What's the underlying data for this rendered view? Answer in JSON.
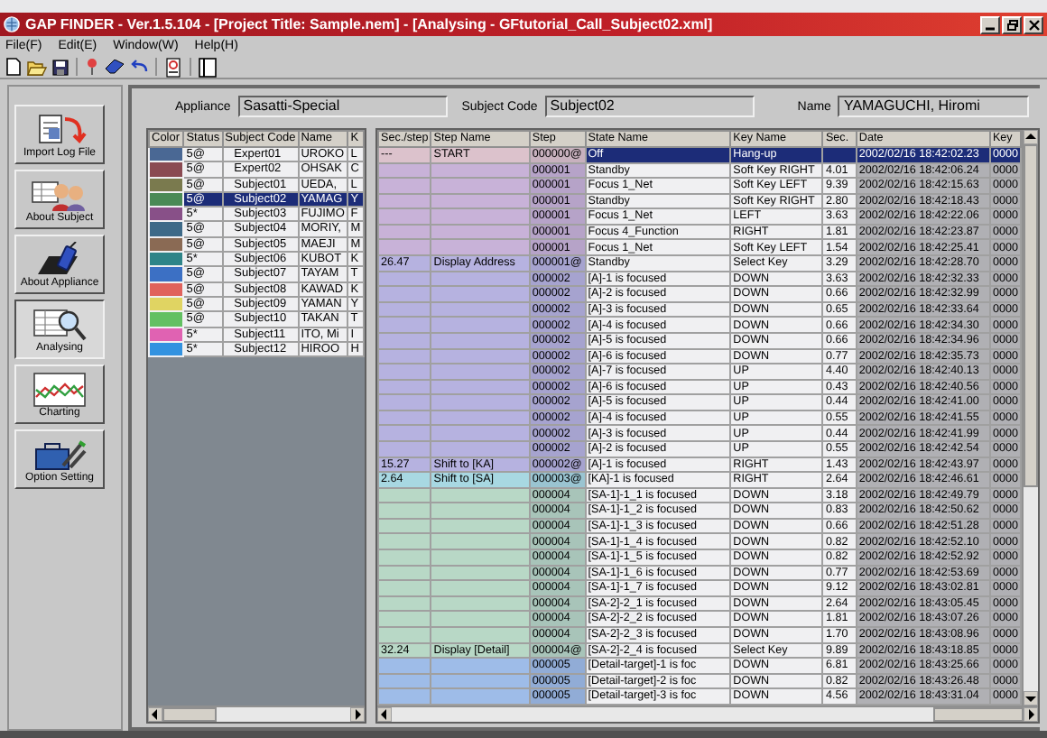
{
  "window": {
    "title": "GAP FINDER - Ver.1.5.104 - [Project Title: Sample.nem] - [Analysing - GFtutorial_Call_Subject02.xml]"
  },
  "menu": [
    "File(F)",
    "Edit(E)",
    "Window(W)",
    "Help(H)"
  ],
  "nav": [
    {
      "label": "Import Log File",
      "kind": "import",
      "selected": false
    },
    {
      "label": "About Subject",
      "kind": "subject",
      "selected": false
    },
    {
      "label": "About Appliance",
      "kind": "appliance",
      "selected": false
    },
    {
      "label": "Analysing",
      "kind": "analysing",
      "selected": true
    },
    {
      "label": "Charting",
      "kind": "charting",
      "selected": false
    },
    {
      "label": "Option Setting",
      "kind": "option",
      "selected": false
    }
  ],
  "header": {
    "appliance_label": "Appliance",
    "appliance": "Sasatti-Special",
    "subject_code_label": "Subject Code",
    "subject_code": "Subject02",
    "name_label": "Name",
    "name": "YAMAGUCHI, Hiromi"
  },
  "subjects": {
    "columns": [
      "Color",
      "Status",
      "Subject Code",
      "Name",
      "K"
    ],
    "rows": [
      {
        "color": "#4a6894",
        "status": "5@",
        "code": "Expert01",
        "name": "UROKO",
        "column_5": "L",
        "selected": false
      },
      {
        "color": "#8a4a52",
        "status": "5@",
        "code": "Expert02",
        "name": "OHSAK",
        "column_5": "C",
        "selected": false
      },
      {
        "color": "#7a7a4e",
        "status": "5@",
        "code": "Subject01",
        "name": "UEDA,",
        "column_5": "L",
        "selected": false
      },
      {
        "color": "#4a8a56",
        "status": "5@",
        "code": "Subject02",
        "name": "YAMAG",
        "column_5": "Y",
        "selected": true
      },
      {
        "color": "#885088",
        "status": "5*",
        "code": "Subject03",
        "name": "FUJIMO",
        "column_5": "F",
        "selected": false
      },
      {
        "color": "#3e6a88",
        "status": "5@",
        "code": "Subject04",
        "name": "MORIY,",
        "column_5": "M",
        "selected": false
      },
      {
        "color": "#8a6a54",
        "status": "5@",
        "code": "Subject05",
        "name": "MAEJI",
        "column_5": "M",
        "selected": false
      },
      {
        "color": "#2e8488",
        "status": "5*",
        "code": "Subject06",
        "name": "KUBOT",
        "column_5": "K",
        "selected": false
      },
      {
        "color": "#3c70c4",
        "status": "5@",
        "code": "Subject07",
        "name": "TAYAM",
        "column_5": "T",
        "selected": false
      },
      {
        "color": "#e0625c",
        "status": "5@",
        "code": "Subject08",
        "name": "KAWAD",
        "column_5": "K",
        "selected": false
      },
      {
        "color": "#e0d462",
        "status": "5@",
        "code": "Subject09",
        "name": "YAMAN",
        "column_5": "Y",
        "selected": false
      },
      {
        "color": "#62c062",
        "status": "5@",
        "code": "Subject10",
        "name": "TAKAN",
        "column_5": "T",
        "selected": false
      },
      {
        "color": "#e062b2",
        "status": "5*",
        "code": "Subject11",
        "name": "ITO, Mi",
        "column_5": "I",
        "selected": false
      },
      {
        "color": "#3292e0",
        "status": "5*",
        "code": "Subject12",
        "name": "HIROO",
        "column_5": "H",
        "selected": false
      }
    ]
  },
  "steps": {
    "columns": [
      "Sec./step",
      "Step Name",
      "Step",
      "State Name",
      "Key Name",
      "Sec.",
      "Date",
      "Key"
    ],
    "rows": [
      {
        "sec_step": "---",
        "step_name": "START",
        "step": "000000@",
        "state_name": "Off",
        "key_name": "Hang-up",
        "date": "2002/02/16 18:42:02.23",
        "key": "0000",
        "color": "#dcc2cc",
        "selected": true
      },
      {
        "step": "000001",
        "state_name": "Standby",
        "key_name": "Soft Key RIGHT",
        "sec": "4.01",
        "date": "2002/02/16 18:42:06.24",
        "key": "0000",
        "color": "#c8b2d8",
        "selected": false
      },
      {
        "step": "000001",
        "state_name": "Focus 1_Net",
        "key_name": "Soft Key LEFT",
        "sec": "9.39",
        "date": "2002/02/16 18:42:15.63",
        "key": "0000",
        "color": "#c8b2d8",
        "selected": false
      },
      {
        "step": "000001",
        "state_name": "Standby",
        "key_name": "Soft Key RIGHT",
        "sec": "2.80",
        "date": "2002/02/16 18:42:18.43",
        "key": "0000",
        "color": "#c8b2d8",
        "selected": false
      },
      {
        "step": "000001",
        "state_name": "Focus 1_Net",
        "key_name": "LEFT",
        "sec": "3.63",
        "date": "2002/02/16 18:42:22.06",
        "key": "0000",
        "color": "#c8b2d8",
        "selected": false
      },
      {
        "step": "000001",
        "state_name": "Focus 4_Function",
        "key_name": "RIGHT",
        "sec": "1.81",
        "date": "2002/02/16 18:42:23.87",
        "key": "0000",
        "color": "#c8b2d8",
        "selected": false
      },
      {
        "step": "000001",
        "state_name": "Focus 1_Net",
        "key_name": "Soft Key LEFT",
        "sec": "1.54",
        "date": "2002/02/16 18:42:25.41",
        "key": "0000",
        "color": "#c8b2d8",
        "selected": false
      },
      {
        "sec_step": "26.47",
        "step_name": "Display Address",
        "step": "000001@",
        "state_name": "Standby",
        "key_name": "Select Key",
        "sec": "3.29",
        "date": "2002/02/16 18:42:28.70",
        "key": "0000",
        "color": "#b6b2e0",
        "selected": false
      },
      {
        "step": "000002",
        "state_name": "[A]-1 is focused",
        "key_name": "DOWN",
        "sec": "3.63",
        "date": "2002/02/16 18:42:32.33",
        "key": "0000",
        "color": "#b6b2e0",
        "selected": false
      },
      {
        "step": "000002",
        "state_name": "[A]-2 is focused",
        "key_name": "DOWN",
        "sec": "0.66",
        "date": "2002/02/16 18:42:32.99",
        "key": "0000",
        "color": "#b6b2e0",
        "selected": false
      },
      {
        "step": "000002",
        "state_name": "[A]-3 is focused",
        "key_name": "DOWN",
        "sec": "0.65",
        "date": "2002/02/16 18:42:33.64",
        "key": "0000",
        "color": "#b6b2e0",
        "selected": false
      },
      {
        "step": "000002",
        "state_name": "[A]-4 is focused",
        "key_name": "DOWN",
        "sec": "0.66",
        "date": "2002/02/16 18:42:34.30",
        "key": "0000",
        "color": "#b6b2e0",
        "selected": false
      },
      {
        "step": "000002",
        "state_name": "[A]-5 is focused",
        "key_name": "DOWN",
        "sec": "0.66",
        "date": "2002/02/16 18:42:34.96",
        "key": "0000",
        "color": "#b6b2e0",
        "selected": false
      },
      {
        "step": "000002",
        "state_name": "[A]-6 is focused",
        "key_name": "DOWN",
        "sec": "0.77",
        "date": "2002/02/16 18:42:35.73",
        "key": "0000",
        "color": "#b6b2e0",
        "selected": false
      },
      {
        "step": "000002",
        "state_name": "[A]-7 is focused",
        "key_name": "UP",
        "sec": "4.40",
        "date": "2002/02/16 18:42:40.13",
        "key": "0000",
        "color": "#b6b2e0",
        "selected": false
      },
      {
        "step": "000002",
        "state_name": "[A]-6 is focused",
        "key_name": "UP",
        "sec": "0.43",
        "date": "2002/02/16 18:42:40.56",
        "key": "0000",
        "color": "#b6b2e0",
        "selected": false
      },
      {
        "step": "000002",
        "state_name": "[A]-5 is focused",
        "key_name": "UP",
        "sec": "0.44",
        "date": "2002/02/16 18:42:41.00",
        "key": "0000",
        "color": "#b6b2e0",
        "selected": false
      },
      {
        "step": "000002",
        "state_name": "[A]-4 is focused",
        "key_name": "UP",
        "sec": "0.55",
        "date": "2002/02/16 18:42:41.55",
        "key": "0000",
        "color": "#b6b2e0",
        "selected": false
      },
      {
        "step": "000002",
        "state_name": "[A]-3 is focused",
        "key_name": "UP",
        "sec": "0.44",
        "date": "2002/02/16 18:42:41.99",
        "key": "0000",
        "color": "#b6b2e0",
        "selected": false
      },
      {
        "step": "000002",
        "state_name": "[A]-2 is focused",
        "key_name": "UP",
        "sec": "0.55",
        "date": "2002/02/16 18:42:42.54",
        "key": "0000",
        "color": "#b6b2e0",
        "selected": false
      },
      {
        "sec_step": "15.27",
        "step_name": "Shift to [KA]",
        "step": "000002@",
        "state_name": "[A]-1 is focused",
        "key_name": "RIGHT",
        "sec": "1.43",
        "date": "2002/02/16 18:42:43.97",
        "key": "0000",
        "color": "#b6b2e0",
        "selected": false
      },
      {
        "sec_step": "2.64",
        "step_name": "Shift to [SA]",
        "step": "000003@",
        "state_name": "[KA]-1 is focused",
        "key_name": "RIGHT",
        "sec": "2.64",
        "date": "2002/02/16 18:42:46.61",
        "key": "0000",
        "color": "#a8d8e2",
        "selected": false
      },
      {
        "step": "000004",
        "state_name": "[SA-1]-1_1 is focused",
        "key_name": "DOWN",
        "sec": "3.18",
        "date": "2002/02/16 18:42:49.79",
        "key": "0000",
        "color": "#b8d8c6",
        "selected": false
      },
      {
        "step": "000004",
        "state_name": "[SA-1]-1_2 is focused",
        "key_name": "DOWN",
        "sec": "0.83",
        "date": "2002/02/16 18:42:50.62",
        "key": "0000",
        "color": "#b8d8c6",
        "selected": false
      },
      {
        "step": "000004",
        "state_name": "[SA-1]-1_3 is focused",
        "key_name": "DOWN",
        "sec": "0.66",
        "date": "2002/02/16 18:42:51.28",
        "key": "0000",
        "color": "#b8d8c6",
        "selected": false
      },
      {
        "step": "000004",
        "state_name": "[SA-1]-1_4 is focused",
        "key_name": "DOWN",
        "sec": "0.82",
        "date": "2002/02/16 18:42:52.10",
        "key": "0000",
        "color": "#b8d8c6",
        "selected": false
      },
      {
        "step": "000004",
        "state_name": "[SA-1]-1_5 is focused",
        "key_name": "DOWN",
        "sec": "0.82",
        "date": "2002/02/16 18:42:52.92",
        "key": "0000",
        "color": "#b8d8c6",
        "selected": false
      },
      {
        "step": "000004",
        "state_name": "[SA-1]-1_6 is focused",
        "key_name": "DOWN",
        "sec": "0.77",
        "date": "2002/02/16 18:42:53.69",
        "key": "0000",
        "color": "#b8d8c6",
        "selected": false
      },
      {
        "step": "000004",
        "state_name": "[SA-1]-1_7 is focused",
        "key_name": "DOWN",
        "sec": "9.12",
        "date": "2002/02/16 18:43:02.81",
        "key": "0000",
        "color": "#b8d8c6",
        "selected": false
      },
      {
        "step": "000004",
        "state_name": "[SA-2]-2_1 is focused",
        "key_name": "DOWN",
        "sec": "2.64",
        "date": "2002/02/16 18:43:05.45",
        "key": "0000",
        "color": "#b8d8c6",
        "selected": false
      },
      {
        "step": "000004",
        "state_name": "[SA-2]-2_2 is focused",
        "key_name": "DOWN",
        "sec": "1.81",
        "date": "2002/02/16 18:43:07.26",
        "key": "0000",
        "color": "#b8d8c6",
        "selected": false
      },
      {
        "step": "000004",
        "state_name": "[SA-2]-2_3 is focused",
        "key_name": "DOWN",
        "sec": "1.70",
        "date": "2002/02/16 18:43:08.96",
        "key": "0000",
        "color": "#b8d8c6",
        "selected": false
      },
      {
        "sec_step": "32.24",
        "step_name": "Display [Detail]",
        "step": "000004@",
        "state_name": "[SA-2]-2_4 is focused",
        "key_name": "Select Key",
        "sec": "9.89",
        "date": "2002/02/16 18:43:18.85",
        "key": "0000",
        "color": "#b8d8c6",
        "selected": false
      },
      {
        "step": "000005",
        "state_name": "[Detail-target]-1 is foc",
        "key_name": "DOWN",
        "sec": "6.81",
        "date": "2002/02/16 18:43:25.66",
        "key": "0000",
        "color": "#9ebce8",
        "selected": false
      },
      {
        "step": "000005",
        "state_name": "[Detail-target]-2 is foc",
        "key_name": "DOWN",
        "sec": "0.82",
        "date": "2002/02/16 18:43:26.48",
        "key": "0000",
        "color": "#9ebce8",
        "selected": false
      },
      {
        "step": "000005",
        "state_name": "[Detail-target]-3 is foc",
        "key_name": "DOWN",
        "sec": "4.56",
        "date": "2002/02/16 18:43:31.04",
        "key": "0000",
        "color": "#9ebce8",
        "selected": false
      }
    ]
  }
}
